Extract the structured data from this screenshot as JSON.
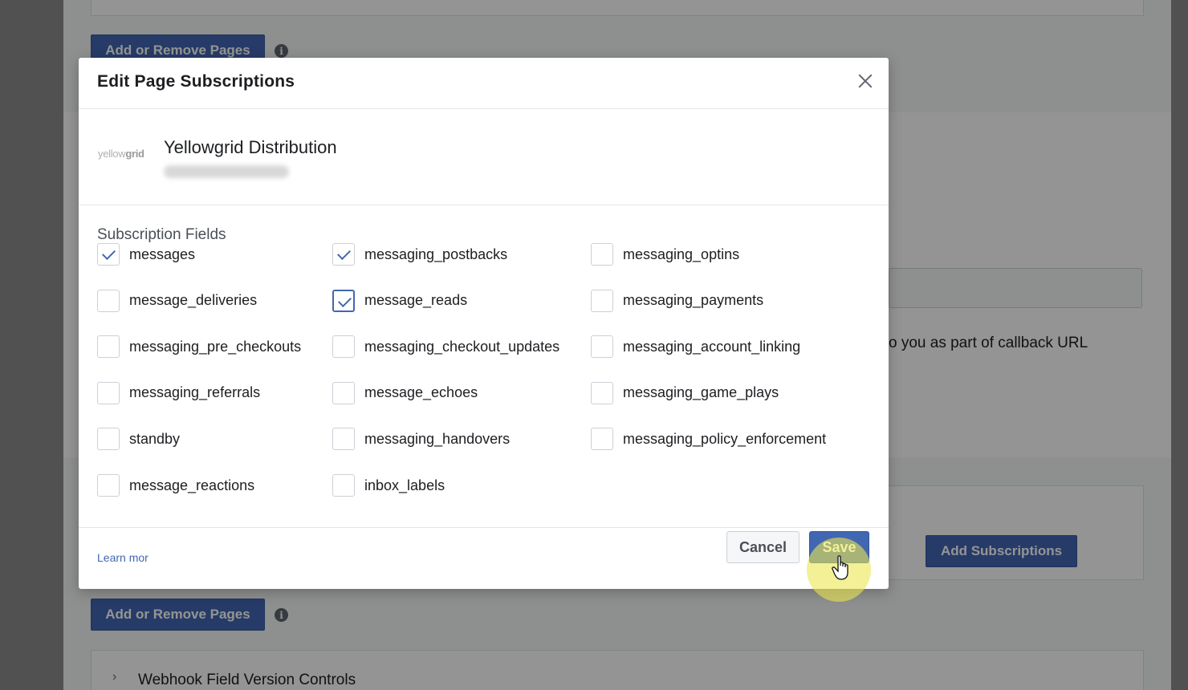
{
  "background": {
    "add_remove_top": "Add or Remove Pages",
    "add_remove_bottom": "Add or Remove Pages",
    "callback_text": "o you as part of callback URL",
    "add_subscriptions": "Add Subscriptions",
    "webhook_versions": "Webhook Field Version Controls"
  },
  "modal": {
    "title": "Edit Page Subscriptions",
    "page": {
      "logo_text_light": "yellow",
      "logo_text_bold": "grid",
      "name": "Yellowgrid Distribution"
    },
    "fields_label": "Subscription Fields",
    "fields": [
      {
        "label": "messages",
        "checked": true
      },
      {
        "label": "messaging_postbacks",
        "checked": true
      },
      {
        "label": "messaging_optins",
        "checked": false
      },
      {
        "label": "message_deliveries",
        "checked": false
      },
      {
        "label": "message_reads",
        "checked": true
      },
      {
        "label": "messaging_payments",
        "checked": false
      },
      {
        "label": "messaging_pre_checkouts",
        "checked": false
      },
      {
        "label": "messaging_checkout_updates",
        "checked": false
      },
      {
        "label": "messaging_account_linking",
        "checked": false
      },
      {
        "label": "messaging_referrals",
        "checked": false
      },
      {
        "label": "message_echoes",
        "checked": false
      },
      {
        "label": "messaging_game_plays",
        "checked": false
      },
      {
        "label": "standby",
        "checked": false
      },
      {
        "label": "messaging_handovers",
        "checked": false
      },
      {
        "label": "messaging_policy_enforcement",
        "checked": false
      },
      {
        "label": "message_reactions",
        "checked": false
      },
      {
        "label": "inbox_labels",
        "checked": false
      }
    ],
    "footer": {
      "learn_more": "Learn mor",
      "cancel": "Cancel",
      "save": "Save"
    }
  },
  "colors": {
    "accent": "#4267b2",
    "highlight": "#ebe650"
  }
}
